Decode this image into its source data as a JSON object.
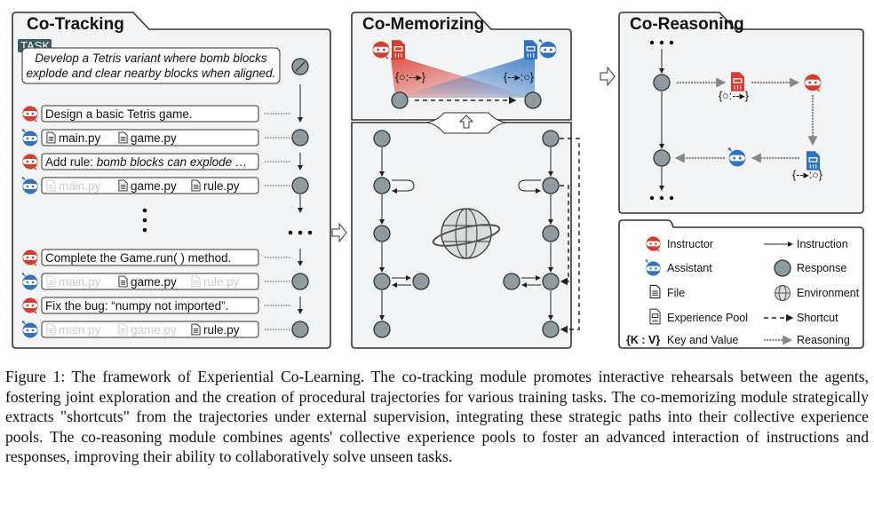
{
  "figure": {
    "panels": {
      "tracking": {
        "title": "Co-Tracking",
        "task_badge": "TASK",
        "task_line1": "Develop a Tetris variant where bomb blocks",
        "task_line2": "explode and clear nearby blocks when aligned.",
        "rows": [
          {
            "role": "instructor",
            "text": "Design a basic Tetris game."
          },
          {
            "role": "assistant",
            "files": [
              {
                "name": "main.py",
                "active": true
              },
              {
                "name": "game.py",
                "active": true
              }
            ]
          },
          {
            "role": "instructor",
            "text_prefix": "Add rule: ",
            "text_italic": "bomb blocks can explode …"
          },
          {
            "role": "assistant",
            "files": [
              {
                "name": "main.py",
                "active": false
              },
              {
                "name": "game.py",
                "active": true
              },
              {
                "name": "rule.py",
                "active": true
              }
            ]
          },
          {
            "role": "instructor",
            "text": "Complete the Game.run( ) method."
          },
          {
            "role": "assistant",
            "files": [
              {
                "name": "main.py",
                "active": false
              },
              {
                "name": "game.py",
                "active": true
              },
              {
                "name": "rule.py",
                "active": false
              }
            ]
          },
          {
            "role": "instructor",
            "text": "Fix the bug: “numpy not imported”."
          },
          {
            "role": "assistant",
            "files": [
              {
                "name": "main.py",
                "active": false
              },
              {
                "name": "game.py",
                "active": false
              },
              {
                "name": "rule.py",
                "active": true
              }
            ]
          }
        ]
      },
      "memorizing": {
        "title": "Co-Memorizing",
        "kv_left": "{○:--▸}",
        "kv_right": "{--▸:○}"
      },
      "reasoning": {
        "title": "Co-Reasoning",
        "kv_left": "{○:--▸}",
        "kv_right": "{--▸:○}"
      }
    },
    "legend": {
      "instructor": "Instructor",
      "assistant": "Assistant",
      "file": "File",
      "experience_pool": "Experience Pool",
      "kv_symbol": "{K : V}",
      "key_value": "Key and Value",
      "instruction": "Instruction",
      "response": "Response",
      "environment": "Environment",
      "shortcut": "Shortcut",
      "reasoning": "Reasoning"
    },
    "colors": {
      "instructor": "#d93a2b",
      "assistant": "#2f72c4",
      "node": "#8e9ca1",
      "panel": "#f2f4f5"
    }
  },
  "caption": "Figure 1: The framework of Experiential Co-Learning. The co-tracking module promotes interactive rehearsals between the agents, fostering joint exploration and the creation of procedural trajectories for various training tasks. The co-memorizing module strategically extracts \"shortcuts\" from the trajectories under external supervision, integrating these strategic paths into their collective experience pools. The co-reasoning module combines agents' collective experience pools to foster an advanced interaction of instructions and responses, improving their ability to collaboratively solve unseen tasks."
}
